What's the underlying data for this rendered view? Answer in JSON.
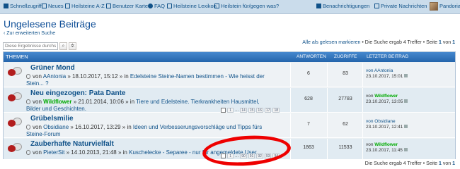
{
  "nav": {
    "schnellzugriff": "Schnellzugriff",
    "neues": "Neues",
    "heilsteine_az": "Heilsteine A-Z",
    "benutzer_karte": "Benutzer Karte",
    "faq": "FAQ",
    "heilsteine_lexikon": "Heilsteine Lexikon",
    "heilstein_fuer_gegen": "Heilstein für/gegen was?",
    "benachrichtigungen": "Benachrichtigungen",
    "private_nachrichten": "Private Nachrichten",
    "user": "Pandoria"
  },
  "page_title": "Ungelesene Beiträge",
  "back_link": "Zur erweiterten Suche",
  "search": {
    "placeholder": "Diese Ergebnisse durchs"
  },
  "meta_top": {
    "mark_all": "Alle als gelesen markieren",
    "sep": " • Die Suche ergab 4 Treffer • Seite ",
    "page": "1",
    "von": " von ",
    "total": "1"
  },
  "table_head": {
    "themen": "THEMEN",
    "antworten": "ANTWORTEN",
    "zugriffe": "ZUGRIFFE",
    "letzter": "LETZTER BEITRAG"
  },
  "topics": [
    {
      "title": "Grüner Mond",
      "by_prefix": "von ",
      "author": "AAntonia",
      "author_green": false,
      "date": " » 18.10.2017, 15:12 » in ",
      "forum_a": "Edelsteine Steine-Namen bestimmen - Wie heisst der",
      "forum_b": "Stein... ?",
      "replies": "6",
      "views": "83",
      "last_by": "von AAntonia",
      "last_date": "23.10.2017, 15:01",
      "pages": []
    },
    {
      "title": "Neu eingezogen: Pata Dante",
      "by_prefix": "von ",
      "author": "Wildflower",
      "author_green": true,
      "date": " » 21.01.2014, 10:06 » in ",
      "forum_a": "Tiere und Edelsteine. Tierkrankheiten Hausmittel,",
      "forum_b": "Bilder und Geschichten.",
      "replies": "628",
      "views": "27783",
      "last_by_prefix": "von ",
      "last_by_user": "Wildflower",
      "last_date": "23.10.2017, 13:05",
      "pages": [
        "1",
        "...",
        "14",
        "15",
        "16",
        "17",
        "18"
      ]
    },
    {
      "title": "Grübelsmilie",
      "by_prefix": "von ",
      "author": "Obsidiane",
      "author_green": false,
      "date": " » 16.10.2017, 13:29 » in ",
      "forum_a": "Ideen und Verbesserungsvorschläge und Tipps fürs",
      "forum_b": "Steine-Forum",
      "replies": "7",
      "views": "62",
      "last_by": "von Obsidiane",
      "last_date": "23.10.2017, 12:41",
      "pages": []
    },
    {
      "title": "Zauberhafte Naturvielfalt",
      "by_prefix": "von ",
      "author": "PieterSit",
      "author_green": false,
      "date": " » 14.10.2013, 21:48 » in ",
      "forum_a": "Kuschelecke - Separee - nur für angemeldete User",
      "forum_b": "",
      "replies": "1863",
      "views": "11533",
      "last_by_prefix": "von ",
      "last_by_user": "Wildflower",
      "last_date": "23.10.2017, 11:45",
      "pages": [
        "1",
        "...",
        "90",
        "91",
        "92",
        "93",
        "94"
      ]
    }
  ],
  "footer": {
    "text": "Die Suche ergab 4 Treffer • Seite ",
    "page": "1",
    "von": " von ",
    "total": "1"
  },
  "colors": {
    "accent": "#105289",
    "header_bar": "#2465ac",
    "green_user": "#00aa00",
    "annotation": "#ee0000"
  }
}
